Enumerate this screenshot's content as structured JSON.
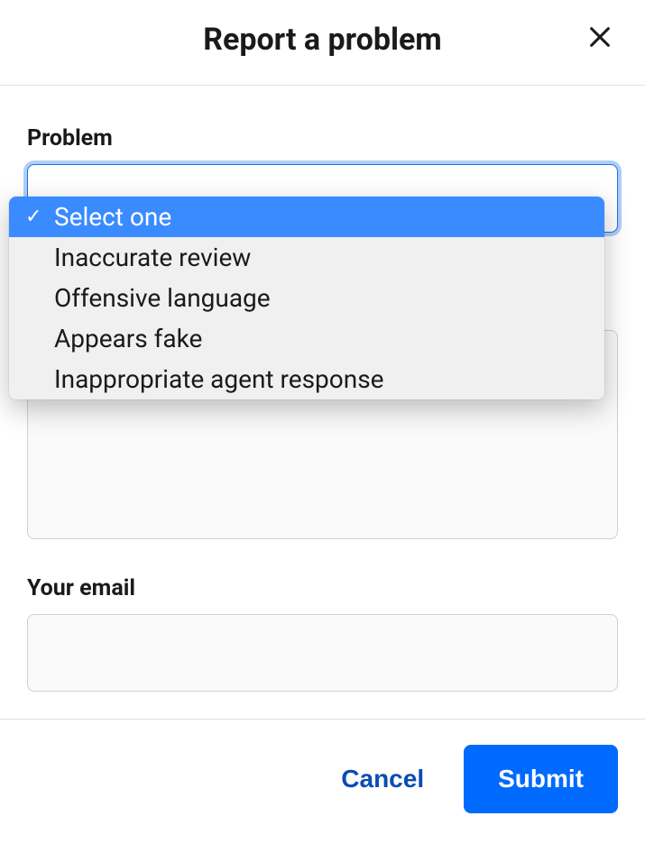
{
  "header": {
    "title": "Report a problem"
  },
  "problem": {
    "label": "Problem",
    "selected_index": 0,
    "options": [
      "Select one",
      "Inaccurate review",
      "Offensive language",
      "Appears fake",
      "Inappropriate agent response"
    ]
  },
  "comment": {
    "value": ""
  },
  "email": {
    "label": "Your email",
    "value": ""
  },
  "footer": {
    "cancel_label": "Cancel",
    "submit_label": "Submit"
  }
}
